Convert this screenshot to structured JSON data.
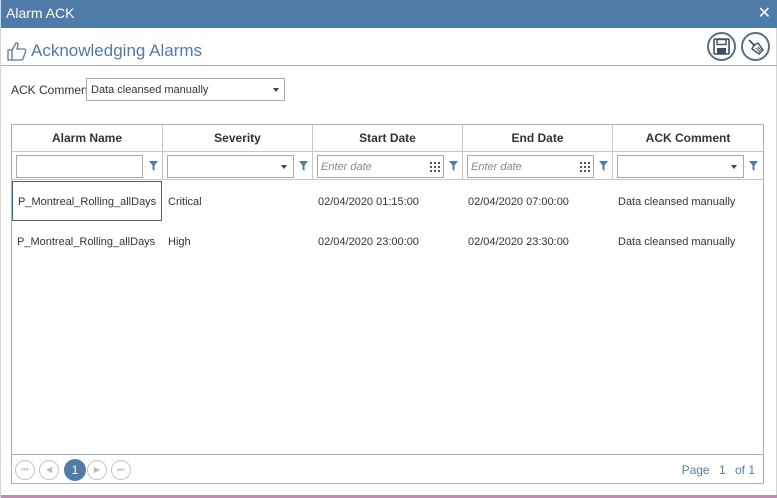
{
  "window": {
    "title": "Alarm ACK",
    "close_glyph": "✕"
  },
  "header": {
    "heading": "Acknowledging Alarms",
    "icon": "thumbs-up-icon"
  },
  "toolbar": {
    "save_icon": "floppy-disk-icon",
    "clear_icon": "broom-icon"
  },
  "ack_comment": {
    "label": "ACK Comment",
    "selected": "Data cleansed manually"
  },
  "grid": {
    "columns": [
      "Alarm Name",
      "Severity",
      "Start Date",
      "End Date",
      "ACK Comment"
    ],
    "filters": {
      "date_placeholder": "Enter date"
    },
    "rows": [
      [
        "P_Montreal_Rolling_allDays",
        "Critical",
        "02/04/2020 01:15:00",
        "02/04/2020 07:00:00",
        "Data cleansed manually"
      ],
      [
        "P_Montreal_Rolling_allDays",
        "High",
        "02/04/2020 23:00:00",
        "02/04/2020 23:30:00",
        "Data cleansed manually"
      ]
    ]
  },
  "pager": {
    "current_page": "1",
    "page_label": "Page",
    "page_value": "1",
    "of_label": "of 1"
  },
  "colors": {
    "accent": "#4f7ba8",
    "border": "#9fb3c8"
  }
}
